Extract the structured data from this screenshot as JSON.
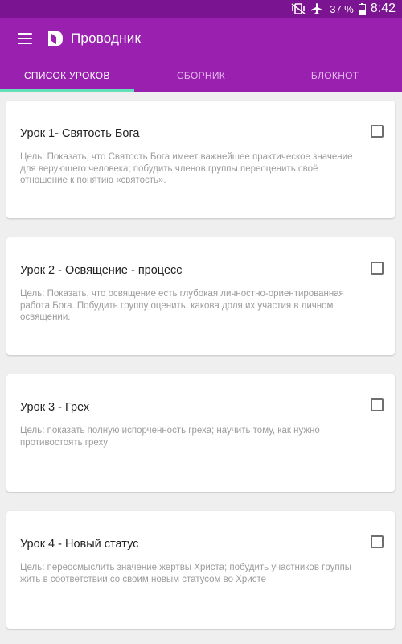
{
  "status_bar": {
    "battery_text": "37 %",
    "time": "8:42",
    "icons": [
      "vibrate-icon",
      "airplane-icon",
      "battery-icon"
    ]
  },
  "app_bar": {
    "title": "Проводник",
    "color": "#9a21b0"
  },
  "tabs": [
    {
      "label": "СПИСОК УРОКОВ",
      "active": true
    },
    {
      "label": "СБОРНИК",
      "active": false
    },
    {
      "label": "БЛОКНОТ",
      "active": false
    }
  ],
  "lessons": [
    {
      "title": "Урок 1- Святость Бога",
      "description": "Цель: Показать, что Святость Бога имеет важнейшее практическое значение для верующего человека; побудить членов группы переоценить своё отношение к понятию «святость».",
      "checked": false
    },
    {
      "title": "Урок 2 - Освящение - процесс",
      "description": "Цель: Показать, что освящение есть глубокая личностно-ориентированная работа Бога. Побудить группу оценить, какова доля их участия в личном освящении.",
      "checked": false
    },
    {
      "title": "Урок 3 - Грех",
      "description": "Цель: показать полную испорченность греха; научить тому, как нужно противостоять греху",
      "checked": false
    },
    {
      "title": "Урок 4 - Новый статус",
      "description": "Цель: переосмыслить значение жертвы Христа; побудить участников группы жить в соответствии со своим новым статусом во Христе",
      "checked": false
    }
  ]
}
